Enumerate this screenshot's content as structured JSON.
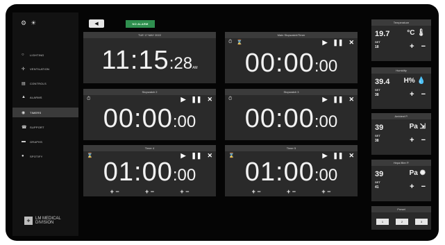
{
  "sidebar": {
    "items": [
      {
        "label": "LIGHTING",
        "icon": "lightbulb-icon"
      },
      {
        "label": "VENTILATION",
        "icon": "fan-icon"
      },
      {
        "label": "CONTROLS",
        "icon": "sliders-icon"
      },
      {
        "label": "ALARMS",
        "icon": "warning-icon"
      },
      {
        "label": "TIMERS",
        "icon": "clock-icon"
      },
      {
        "label": "SUPPORT",
        "icon": "phone-icon"
      },
      {
        "label": "GRAPHS",
        "icon": "chart-icon"
      },
      {
        "label": "SPOTIFY",
        "icon": "spotify-icon"
      }
    ],
    "active": "TIMERS",
    "logo_line1": "LM MEDICAL",
    "logo_line2": "DIVISION"
  },
  "topbar": {
    "alarm_status": "NO ALARM",
    "alarm_color": "#2f8f4f"
  },
  "clock": {
    "date": "TUE 17 MAY 2022",
    "hhmm": "11:15",
    "seconds": ":28",
    "ampm": "AM"
  },
  "timers": {
    "main_stopwatch": {
      "title": "Main Stopwatch/Timer",
      "big": "00:00",
      "small": ":00"
    },
    "stopwatch2": {
      "title": "Stopwatch 2",
      "big": "00:00",
      "small": ":00"
    },
    "stopwatch3": {
      "title": "Stopwatch 3",
      "big": "00:00",
      "small": ":00"
    },
    "timer4": {
      "title": "Timer 4",
      "big": "01:00",
      "small": ":00"
    },
    "timer5": {
      "title": "Timer 5",
      "big": "01:00",
      "small": ":00"
    }
  },
  "controls": {
    "play": "▶",
    "pause": "❚❚",
    "stop": "✕",
    "plus": "+",
    "minus": "−",
    "plus_minus": "+ −"
  },
  "env": {
    "set_label": "SET",
    "temperature": {
      "title": "Temperature",
      "value": "19.7",
      "unit": "°C",
      "set": "18"
    },
    "humidity": {
      "title": "Humidity",
      "value": "39.4",
      "unit": "H%",
      "set": "38"
    },
    "ambient": {
      "title": "Ambient P.",
      "value": "39",
      "unit": "Pa",
      "set": "38"
    },
    "hepa": {
      "title": "Hepa filter P.",
      "value": "39",
      "unit": "Pa",
      "set": "41"
    }
  },
  "preset": {
    "title": "Preset",
    "buttons": [
      "1",
      "2",
      "3"
    ]
  }
}
